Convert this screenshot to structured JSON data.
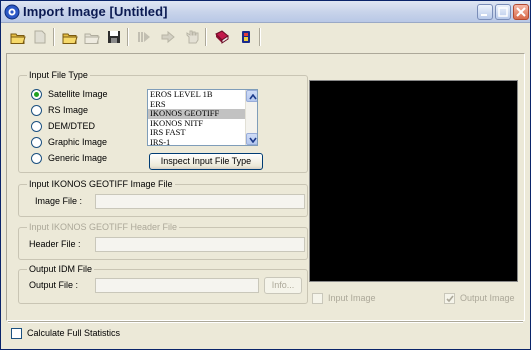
{
  "window": {
    "title": "Import Image [Untitled]",
    "icons": [
      "app-icon",
      "minimize-icon",
      "maximize-icon",
      "close-icon"
    ]
  },
  "toolbar": {
    "icons": [
      "open-folder-icon",
      "disabled-document-icon",
      "open-file-icon",
      "disabled-open-icon",
      "save-icon",
      "disabled-play-icon",
      "disabled-forward-icon",
      "disabled-hand-icon",
      "book-icon",
      "info-icon"
    ]
  },
  "input_file_type": {
    "label": "Input File Type",
    "options": [
      {
        "label": "Satellite Image",
        "checked": true
      },
      {
        "label": "RS Image",
        "checked": false
      },
      {
        "label": "DEM/DTED",
        "checked": false
      },
      {
        "label": "Graphic Image",
        "checked": false
      },
      {
        "label": "Generic Image",
        "checked": false
      }
    ],
    "list_items": [
      "EROS LEVEL 1B",
      "ERS",
      "IKONOS GEOTIFF",
      "IKONOS NITF",
      "IRS FAST",
      "IRS-1"
    ],
    "selected_item": "IKONOS GEOTIFF",
    "inspect_button": "Inspect Input File Type"
  },
  "input_image_group": {
    "label": "Input IKONOS GEOTIFF Image File",
    "field_label": "Image File :",
    "value": ""
  },
  "header_group": {
    "label": "Input IKONOS GEOTIFF Header File",
    "field_label": "Header File :",
    "value": ""
  },
  "output_group": {
    "label": "Output IDM File",
    "field_label": "Output File :",
    "value": "",
    "info_button": "Info..."
  },
  "preview": {
    "input_image_label": "Input Image",
    "input_image_checked": false,
    "output_image_label": "Output Image",
    "output_image_checked": true
  },
  "footer": {
    "calc_stats_label": "Calculate Full Statistics",
    "calc_stats_checked": false
  },
  "colors": {
    "face": "#ece9d8",
    "preview_bg": "#000000",
    "title_text": "#0b1a52"
  }
}
